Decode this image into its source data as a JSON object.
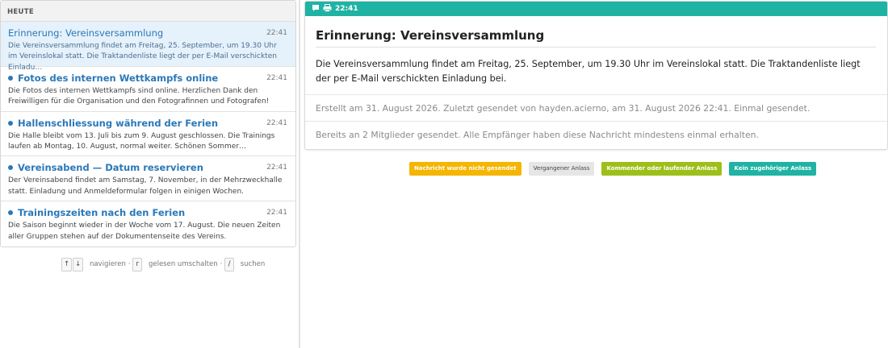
{
  "list": {
    "header": "HEUTE",
    "items": [
      {
        "title": "Erinnerung: Vereinsversammlung",
        "time": "22:41",
        "body": "Die Vereinsversammlung findet am Freitag, 25. September, um 19.30 Uhr im Vereinslokal statt. Die Traktandenliste liegt der per E-Mail verschickten Einladu…"
      },
      {
        "title": "Fotos des internen Wettkampfs online",
        "time": "22:41",
        "body": "Die Fotos des internen Wettkampfs sind online. Herzlichen Dank den Freiwilligen für die Organisation und den Fotografinnen und Fotografen!"
      },
      {
        "title": "Hallenschliessung während der Ferien",
        "time": "22:41",
        "body": "Die Halle bleibt vom 13. Juli bis zum 9. August geschlossen. Die Trainings laufen ab Montag, 10. August, normal weiter. Schönen Sommer…"
      },
      {
        "title": "Vereinsabend — Datum reservieren",
        "time": "22:41",
        "body": "Der Vereinsabend findet am Samstag, 7. November, in der Mehrzweckhalle statt. Einladung und Anmeldeformular folgen in einigen Wochen."
      },
      {
        "title": "Trainingszeiten nach den Ferien",
        "time": "22:41",
        "body": "Die Saison beginnt wieder in der Woche vom 17. August. Die neuen Zeiten aller Gruppen stehen auf der Dokumentenseite des Vereins."
      }
    ]
  },
  "hints": {
    "key_up": "↑",
    "key_down": "↓",
    "navigate": "navigieren",
    "sep": "·",
    "key_r": "r",
    "toggle_read": "gelesen umschalten",
    "key_slash": "/",
    "search": "suchen"
  },
  "detail": {
    "time": "22:41",
    "icons": [
      "message-icon",
      "print-icon"
    ],
    "title": "Erinnerung: Vereinsversammlung",
    "body": "Die Vereinsversammlung findet am Freitag, 25. September, um 19.30 Uhr im Vereinslokal statt. Die Traktandenliste liegt der per E-Mail verschickten Einladung bei.",
    "meta": "Erstellt am 31. August 2026. Zuletzt gesendet von hayden.acierno, am 31. August 2026 22:41. Einmal gesendet.",
    "recipients": "Bereits an 2 Mitglieder gesendet. Alle Empfänger haben diese Nachricht mindestens einmal erhalten."
  },
  "legend": {
    "not_sent": "Nachricht wurde nicht gesendet",
    "past": "Vergangener Anlass",
    "upcoming": "Kommender oder laufender Anlass",
    "none": "Kein zugehöriger Anlass"
  },
  "colors": {
    "accent": "#1fb3a3",
    "link": "#2a78b8",
    "not_sent": "#f5b500",
    "past": "#e6e6e6",
    "upcoming": "#9dbf1a",
    "none": "#1fb3a3"
  }
}
